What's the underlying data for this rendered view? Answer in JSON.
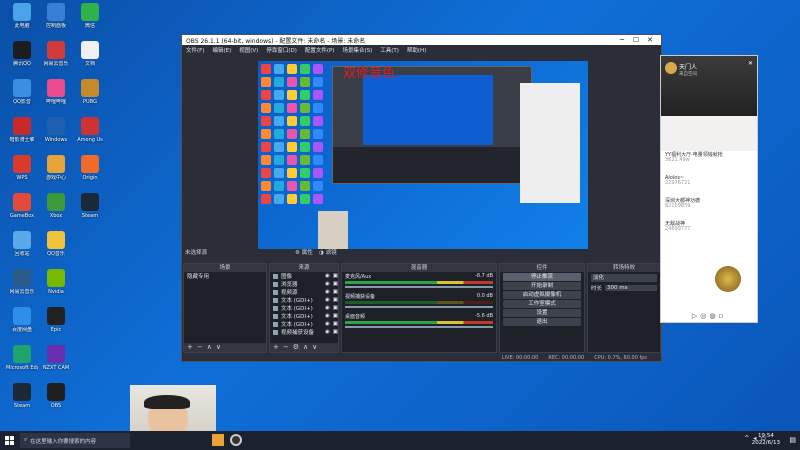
{
  "desktop": {
    "icons": [
      {
        "label": "此电脑",
        "color": "#4aa3e8"
      },
      {
        "label": "腾讯QQ",
        "color": "#1d1d1d"
      },
      {
        "label": "QQ影音",
        "color": "#3b8ee0"
      },
      {
        "label": "暗影骑士擎",
        "color": "#c72a2a"
      },
      {
        "label": "WPS",
        "color": "#d93a2b"
      },
      {
        "label": "GameBox",
        "color": "#e24a3b"
      },
      {
        "label": "回收站",
        "color": "#5aa8e8"
      },
      {
        "label": "网易云音乐",
        "color": "#2b5a8a"
      },
      {
        "label": "百度网盘",
        "color": "#2e8fe8"
      },
      {
        "label": "Microsoft Edge",
        "color": "#1fa36d"
      },
      {
        "label": "Steam",
        "color": "#1b2838"
      },
      {
        "label": "控制面板",
        "color": "#3a7fd5"
      },
      {
        "label": "网易云音乐",
        "color": "#d33a3a"
      },
      {
        "label": "哔哩哔哩",
        "color": "#e94a8c"
      },
      {
        "label": "Windows",
        "color": "#1f5fb0"
      },
      {
        "label": "游戏中心",
        "color": "#e8a23a"
      },
      {
        "label": "Xbox",
        "color": "#3c9a3c"
      },
      {
        "label": "QQ音乐",
        "color": "#f0c23b"
      },
      {
        "label": "Nvidia",
        "color": "#76b900"
      },
      {
        "label": "Epic",
        "color": "#222"
      },
      {
        "label": "NZXT CAM",
        "color": "#6a2fb0"
      },
      {
        "label": "OBS",
        "color": "#1e1e1e"
      },
      {
        "label": "微信",
        "color": "#2fb24a"
      },
      {
        "label": "文档",
        "color": "#f0f0f0"
      },
      {
        "label": "PUBG",
        "color": "#c48a2a"
      },
      {
        "label": "Among Us",
        "color": "#c33"
      },
      {
        "label": "Origin",
        "color": "#f06b2a"
      },
      {
        "label": "Steam",
        "color": "#1b2838"
      }
    ]
  },
  "obs": {
    "title": "OBS 26.1.1 (64-bit, windows) - 配置文件: 未命名 - 场景: 未命名",
    "menu": [
      "文件(F)",
      "编辑(E)",
      "视图(V)",
      "停靠窗口(D)",
      "配置文件(P)",
      "场景集合(S)",
      "工具(T)",
      "帮助(H)"
    ],
    "overlay_text": "双修音色",
    "no_source_label": "未选择源",
    "properties_label": "属性",
    "filters_label": "滤镜",
    "docks": {
      "scenes": {
        "title": "场景",
        "items": [
          "隐藏专用"
        ]
      },
      "sources": {
        "title": "来源",
        "items": [
          "图像",
          "浏览器",
          "视频源",
          "文本 (GDI+)",
          "文本 (GDI+)",
          "文本 (GDI+)",
          "文本 (GDI+)",
          "视频捕获设备"
        ]
      },
      "mixer": {
        "title": "混音器",
        "rows": [
          {
            "name": "麦克风/Aux",
            "db": "-8.7 dB"
          },
          {
            "name": "视频捕获设备",
            "db": "0.0 dB"
          },
          {
            "name": "桌面音频",
            "db": "-5.6 dB"
          }
        ]
      },
      "transitions": {
        "title": "转场特效",
        "type": "淡化",
        "duration_label": "时长",
        "duration": "300 ms"
      },
      "controls": {
        "title": "控件",
        "buttons": [
          "停止推流",
          "开始录制",
          "启动虚拟摄像机",
          "工作室模式",
          "设置",
          "退出"
        ]
      }
    },
    "status": {
      "dropped": "LIVE: 00:00:00",
      "rec": "REC: 00:00:00",
      "cpu": "CPU: 0.7%, 60.00 fps"
    }
  },
  "qq": {
    "name": "天门人",
    "subtitle": "来自空间",
    "posts": [
      {
        "title": "YY福利大厅·电量领钱就抢",
        "sub": "3621.49w"
      },
      {
        "title": "Aiolos~",
        "sub": "22976721"
      },
      {
        "title": "深圳大都神功德",
        "sub": "82109859"
      },
      {
        "title": "无敌战神",
        "sub": "24699777"
      }
    ]
  },
  "taskbar": {
    "search_placeholder": "在这里输入你要搜索的内容",
    "time": "19:54",
    "date": "2022/6/13"
  }
}
